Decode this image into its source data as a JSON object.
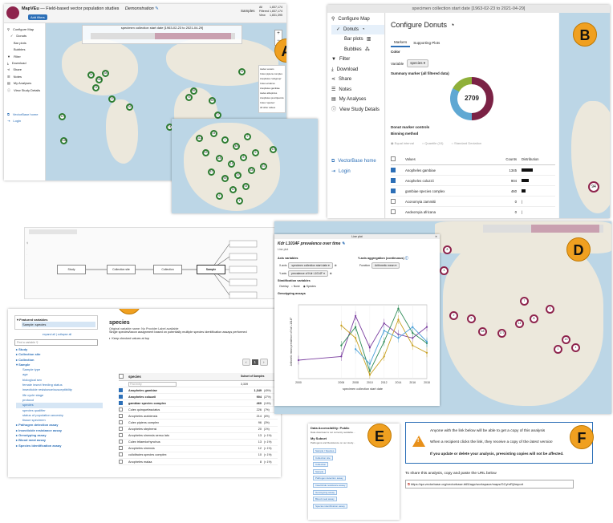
{
  "panelA": {
    "badge": "A",
    "app_name": "MapVEu",
    "app_subtitle": "Field-based vector population studies",
    "study": "Demonstration",
    "add_filters": "Add filters",
    "samples_label": "Samples",
    "counts": [
      {
        "label": "All",
        "value": "1,837,174"
      },
      {
        "label": "Filtered",
        "value": "1,837,174"
      },
      {
        "label": "View",
        "value": "1,831,395"
      }
    ],
    "timeline_title": "specimen collection start date",
    "timeline_range": "[1963-02-23 to 2021-04-29]",
    "menu": [
      "Configure Map",
      "Donuts",
      "Bar plots",
      "Bubbles",
      "Filter",
      "Download",
      "Share",
      "Notes",
      "My Analyses",
      "View Study Details"
    ],
    "vectorbase_home": "VectorBase home",
    "login": "Login",
    "legend": [
      "Aedes vexans",
      "Culex pipiens complex",
      "Anopheles 'subgroup'",
      "Culex erraticus",
      "Anopheles gambiae",
      "Aedes albopictus",
      "Anopheles punctipennis",
      "Culex 'species'",
      "All other values"
    ],
    "markers": [
      "24",
      "162",
      "38",
      "21",
      "12",
      "148",
      "85",
      "74",
      "76",
      "58",
      "11",
      "23",
      "35",
      "27"
    ],
    "zoom_markers": [
      "112",
      "24",
      "1",
      "48",
      "63",
      "2",
      "24",
      "14",
      "8",
      "6",
      "87",
      "55",
      "29",
      "34",
      "37",
      "11",
      "44",
      "4",
      "6",
      "13"
    ]
  },
  "panelB": {
    "badge": "B",
    "header_title": "specimen collection start date [1963-02-23 to 2021-04-29]",
    "menu_configure": "Configure Map",
    "menu_donuts": "Donuts",
    "menu_barplots": "Bar plots",
    "menu_bubbles": "Bubbles",
    "menu_filter": "Filter",
    "menu_download": "Download",
    "menu_share": "Share",
    "menu_notes": "Notes",
    "menu_analyses": "My Analyses",
    "menu_details": "View Study Details",
    "vectorbase_home": "VectorBase home",
    "login": "Login",
    "title": "Configure Donuts",
    "tab_markers": "Markers",
    "tab_supporting": "Supporting Plots",
    "color_label": "Color",
    "variable_label": "Variable",
    "variable_value": "species",
    "summary_label": "Summary marker (all filtered data)",
    "donut_total": "2709",
    "donut_controls": "Donut marker controls",
    "binning_method": "Binning method",
    "binning_options": [
      "Equal interval",
      "Quantile (10)",
      "Standard Deviation"
    ],
    "table_headers": [
      "Values",
      "Counts",
      "Distribution"
    ],
    "rows": [
      {
        "value": "Anopheles gambiae",
        "count": "1345",
        "checked": true,
        "dist": 1.0
      },
      {
        "value": "Anopheles coluzzii",
        "count": "904",
        "checked": true,
        "dist": 0.67
      },
      {
        "value": "gambiae species complex",
        "count": "460",
        "checked": true,
        "dist": 0.34
      },
      {
        "value": "Aconomyia zammitii",
        "count": "0",
        "checked": false,
        "dist": 0
      },
      {
        "value": "Aedeomyia africana",
        "count": "0",
        "checked": false,
        "dist": 0
      }
    ],
    "map_marker": "94"
  },
  "panelC": {
    "badge": "C",
    "featured_title": "Featured variables",
    "featured_item": "Sample: species",
    "expand_all": "expand all",
    "collapse_all": "collapse all",
    "find_placeholder": "Find a variable",
    "tree": [
      "Study",
      "Collection site",
      "Collection",
      "Sample",
      "Sample type",
      "age",
      "biological sex",
      "female insect feeding status",
      "insecticide resistance/susceptibility",
      "life cycle stage",
      "protocol",
      "species",
      "species qualifier",
      "status of population ancestry",
      "tissue specimen",
      "Pathogen detection assay",
      "Insecticide resistance assay",
      "Genotyping assay",
      "Blood meal assay",
      "Species identification assay"
    ],
    "var_title": "species",
    "var_original": "Original variable name: No Provider Label available",
    "var_desc": "Single species/taxon assignment based on potentially multiple species identification assays performed",
    "keep_checked": "Keep checked values at top",
    "page_num": "1",
    "col_species": "species",
    "col_subset": "Subset of Samples",
    "find_entry": "Find entry",
    "total": "3,339",
    "list": [
      {
        "name": "Anopheles gambiae",
        "count": "1,349",
        "pct": "(40%)",
        "checked": true
      },
      {
        "name": "Anopheles coluzzii",
        "count": "904",
        "pct": "(27%)",
        "checked": true
      },
      {
        "name": "gambiae species complex",
        "count": "460",
        "pct": "(14%)",
        "checked": true
      },
      {
        "name": "Culex quinquefasciatus",
        "count": "226",
        "pct": "(7%)",
        "checked": false
      },
      {
        "name": "Anopheles arabiensis",
        "count": "214",
        "pct": "(6%)",
        "checked": false
      },
      {
        "name": "Culex pipiens complex",
        "count": "96",
        "pct": "(3%)",
        "checked": false
      },
      {
        "name": "Anopheles stephensi",
        "count": "20",
        "pct": "(1%)",
        "checked": false
      },
      {
        "name": "Anopheles sinensis sensu lato",
        "count": "13",
        "pct": "(< 1%)",
        "checked": false
      },
      {
        "name": "Culex tritaeniorhynchus",
        "count": "13",
        "pct": "(< 1%)",
        "checked": false
      },
      {
        "name": "Anopheles sinensis",
        "count": "12",
        "pct": "(< 1%)",
        "checked": false
      },
      {
        "name": "culicifacies species complex",
        "count": "10",
        "pct": "(< 1%)",
        "checked": false
      },
      {
        "name": "Anopheles malaa",
        "count": "8",
        "pct": "(< 1%)",
        "checked": false
      }
    ],
    "diagram_nodes": [
      "Study",
      "Collection site",
      "Collection",
      "Sample"
    ]
  },
  "panelD": {
    "badge": "D",
    "window_title": "Line plot",
    "title": "Kdr L1014F prevalence over time",
    "subtitle": "Line plot",
    "axis_variables": "Axis variables",
    "x_axis_label": "X-axis",
    "x_axis_value": "specimen collection start date",
    "y_axis_label": "Y-axis",
    "y_axis_value": "prevalence of Kdr L1014F",
    "y_aggregation": "Y-axis aggregation (continuous)",
    "function_label": "Function",
    "function_value": "Arithmetic mean",
    "stratification": "Stratification variables",
    "overlay_label": "Overlay",
    "none_label": "None",
    "species_label": "Species",
    "genotyping": "Genotyping assays",
    "plot_xlabel": "specimen collection start date",
    "plot_ylabel": "Arithmetic mean prevalence of Kdr L1014F",
    "x_ticks": [
      "2000",
      "2006",
      "2008",
      "2010",
      "2012",
      "2014",
      "2016",
      "2018"
    ],
    "map_markers": [
      "8",
      "1",
      "2",
      "5",
      "18",
      "7",
      "177",
      "14",
      "8",
      "3",
      "1",
      "13",
      "1"
    ]
  },
  "chart_data": {
    "type": "line",
    "x": [
      2000,
      2006,
      2008,
      2010,
      2012,
      2014,
      2016,
      2018
    ],
    "series": [
      {
        "values": [
          0.25,
          0.3,
          0.85,
          0.42,
          0.75,
          0.6,
          0.55,
          0.7
        ]
      },
      {
        "values": [
          null,
          0.45,
          0.7,
          0.1,
          0.5,
          0.95,
          0.62,
          0.48
        ]
      },
      {
        "values": [
          null,
          0.72,
          0.55,
          0.05,
          0.3,
          0.8,
          0.45,
          0.35
        ]
      },
      {
        "values": [
          null,
          null,
          0.4,
          0.2,
          0.65,
          0.55,
          0.7,
          0.5
        ]
      }
    ],
    "colors": [
      "#7b3fa0",
      "#2e8b57",
      "#c8a020",
      "#4aa0d8"
    ],
    "xlabel": "specimen collection start date",
    "ylabel": "Arithmetic mean prevalence of Kdr L1014F",
    "xlim": [
      2000,
      2018
    ],
    "ylim": [
      0,
      1
    ]
  },
  "panelE": {
    "badge": "E",
    "title": "Data Accessibility: Public",
    "desc": "Data download is not currently available...",
    "subset_title": "My Subset",
    "subset_desc": "Pathogens and Resistance on our study...",
    "items": [
      "Sample / Species",
      "Collection site",
      "Collection",
      "Sample",
      "Pathogen detection assay",
      "Insecticide resistance assay",
      "Genotyping assay",
      "Blood meal assay",
      "Species identification assay"
    ]
  },
  "panelF": {
    "badge": "F",
    "line1": "Anyone with the link below will be able to get a copy of this analysis",
    "line2": "When a recipient clicks the link, they receive a copy of the",
    "line2_em": "latest version",
    "line3": "If you update or delete your analysis, preexisting copies will not be affected.",
    "share_text": "To share this analysis, copy and paste the URL below",
    "url": "https://qa.vectorbase.org/vectorbase.b65/app/workspace/maps/GCyhrRj/import"
  },
  "colors": {
    "badge": "#f0a020",
    "green_marker": "#2e7d32",
    "purple_marker": "#8e244d",
    "link": "#2c6fb7",
    "warning": "#e8901a"
  }
}
